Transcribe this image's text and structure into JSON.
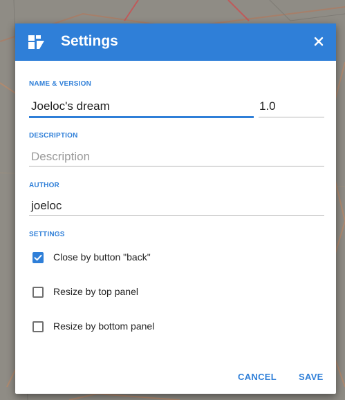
{
  "dialog": {
    "title": "Settings",
    "title_icon": "dashboard-icon",
    "close_icon": "close-icon"
  },
  "sections": {
    "name_version_label": "NAME & VERSION",
    "description_label": "DESCRIPTION",
    "author_label": "AUTHOR",
    "settings_label": "SETTINGS"
  },
  "fields": {
    "name_value": "Joeloc's dream",
    "version_value": "1.0",
    "description_value": "",
    "description_placeholder": "Description",
    "author_value": "joeloc"
  },
  "options": [
    {
      "label": "Close by button \"back\"",
      "checked": true
    },
    {
      "label": "Resize by top panel",
      "checked": false
    },
    {
      "label": "Resize by bottom panel",
      "checked": false
    }
  ],
  "actions": {
    "cancel_label": "CANCEL",
    "save_label": "SAVE"
  },
  "colors": {
    "accent": "#2f7fd8",
    "title_bar": "#2f7fd8",
    "dialog_bg": "#ffffff"
  }
}
